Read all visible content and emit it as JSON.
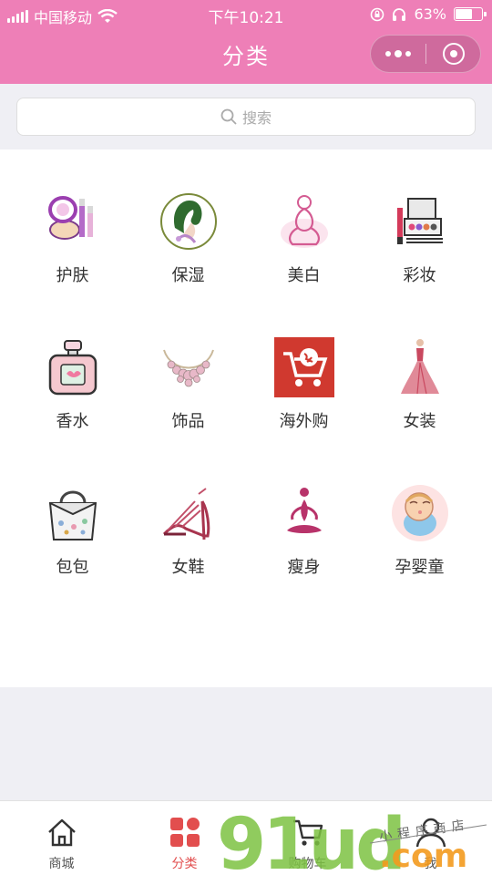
{
  "status": {
    "carrier": "中国移动",
    "time": "下午10:21",
    "battery_percent": "63%",
    "battery_level": 0.63
  },
  "nav": {
    "title": "分类"
  },
  "search": {
    "placeholder": "搜索"
  },
  "categories": [
    {
      "label": "护肤",
      "icon": "lipstick-cosmetics-icon"
    },
    {
      "label": "保湿",
      "icon": "woman-profile-leaf-icon"
    },
    {
      "label": "美白",
      "icon": "woman-figure-icon"
    },
    {
      "label": "彩妆",
      "icon": "makeup-palette-icon"
    },
    {
      "label": "香水",
      "icon": "perfume-bottle-icon"
    },
    {
      "label": "饰品",
      "icon": "necklace-icon"
    },
    {
      "label": "海外购",
      "icon": "global-cart-icon"
    },
    {
      "label": "女装",
      "icon": "gown-dress-icon"
    },
    {
      "label": "包包",
      "icon": "handbag-icon"
    },
    {
      "label": "女鞋",
      "icon": "high-heel-icon"
    },
    {
      "label": "瘦身",
      "icon": "yoga-figure-icon"
    },
    {
      "label": "孕婴童",
      "icon": "baby-icon"
    }
  ],
  "tabs": [
    {
      "label": "商城",
      "icon": "home-icon",
      "active": false
    },
    {
      "label": "分类",
      "icon": "category-grid-icon",
      "active": true
    },
    {
      "label": "购物车",
      "icon": "cart-icon",
      "active": false
    },
    {
      "label": "我",
      "icon": "user-icon",
      "active": false
    }
  ],
  "watermark": {
    "text": "91ud.com",
    "caption": "小程序商店"
  },
  "colors": {
    "header": "#ee7fb7",
    "active_tab": "#e24e4e",
    "watermark_green": "#7dc242",
    "watermark_orange": "#f39a1e"
  }
}
